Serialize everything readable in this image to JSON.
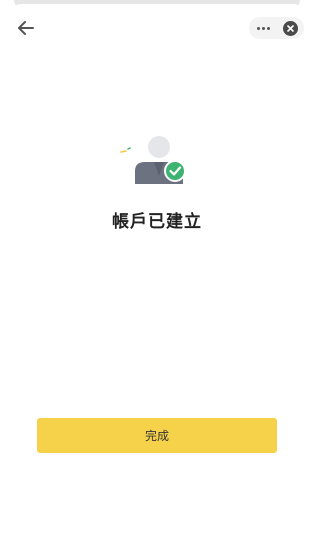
{
  "header": {
    "back_icon": "arrow-left-icon",
    "more_icon": "more-dots-icon",
    "close_icon": "close-circle-icon"
  },
  "illustration": {
    "icon": "user-verified-icon",
    "badge_color": "#3cb371",
    "person_color": "#6c7280"
  },
  "main": {
    "title": "帳戶已建立"
  },
  "footer": {
    "done_label": "完成",
    "button_color": "#f5d24a"
  }
}
